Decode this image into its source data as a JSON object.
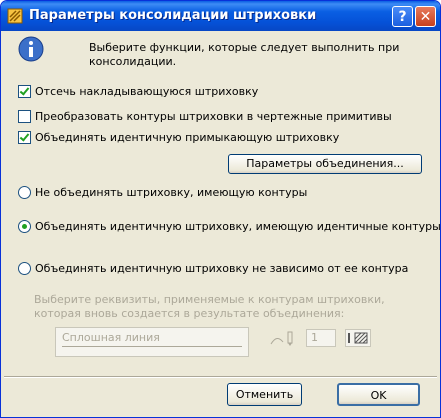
{
  "window": {
    "title": "Параметры консолидации штриховки",
    "help_label": "?",
    "close_label": "✕"
  },
  "intro": "Выберите функции, которые следует выполнить при консолидации.",
  "checkboxes": [
    {
      "label": "Отсечь накладывающуюся штриховку",
      "checked": true
    },
    {
      "label": "Преобразовать контуры штриховки в чертежные примитивы",
      "checked": false
    },
    {
      "label": "Объединять идентичную примыкающую штриховку",
      "checked": true
    }
  ],
  "merge_params_button": "Параметры объединения...",
  "radios": [
    {
      "label": "Не объединять штриховку, имеющую контуры",
      "selected": false
    },
    {
      "label": "Объединять идентичную штриховку, имеющую идентичные контуры",
      "selected": true
    },
    {
      "label": "Объединять идентичную штриховку не зависимо от ее контура",
      "selected": false
    }
  ],
  "props_text": "Выберите реквизиты, применяемые к контурам штриховки, которая вновь создается в результате объединения:",
  "line_type": "Сплошная линия",
  "pen_number": "1",
  "cancel_button": "Отменить",
  "ok_button": "OK"
}
